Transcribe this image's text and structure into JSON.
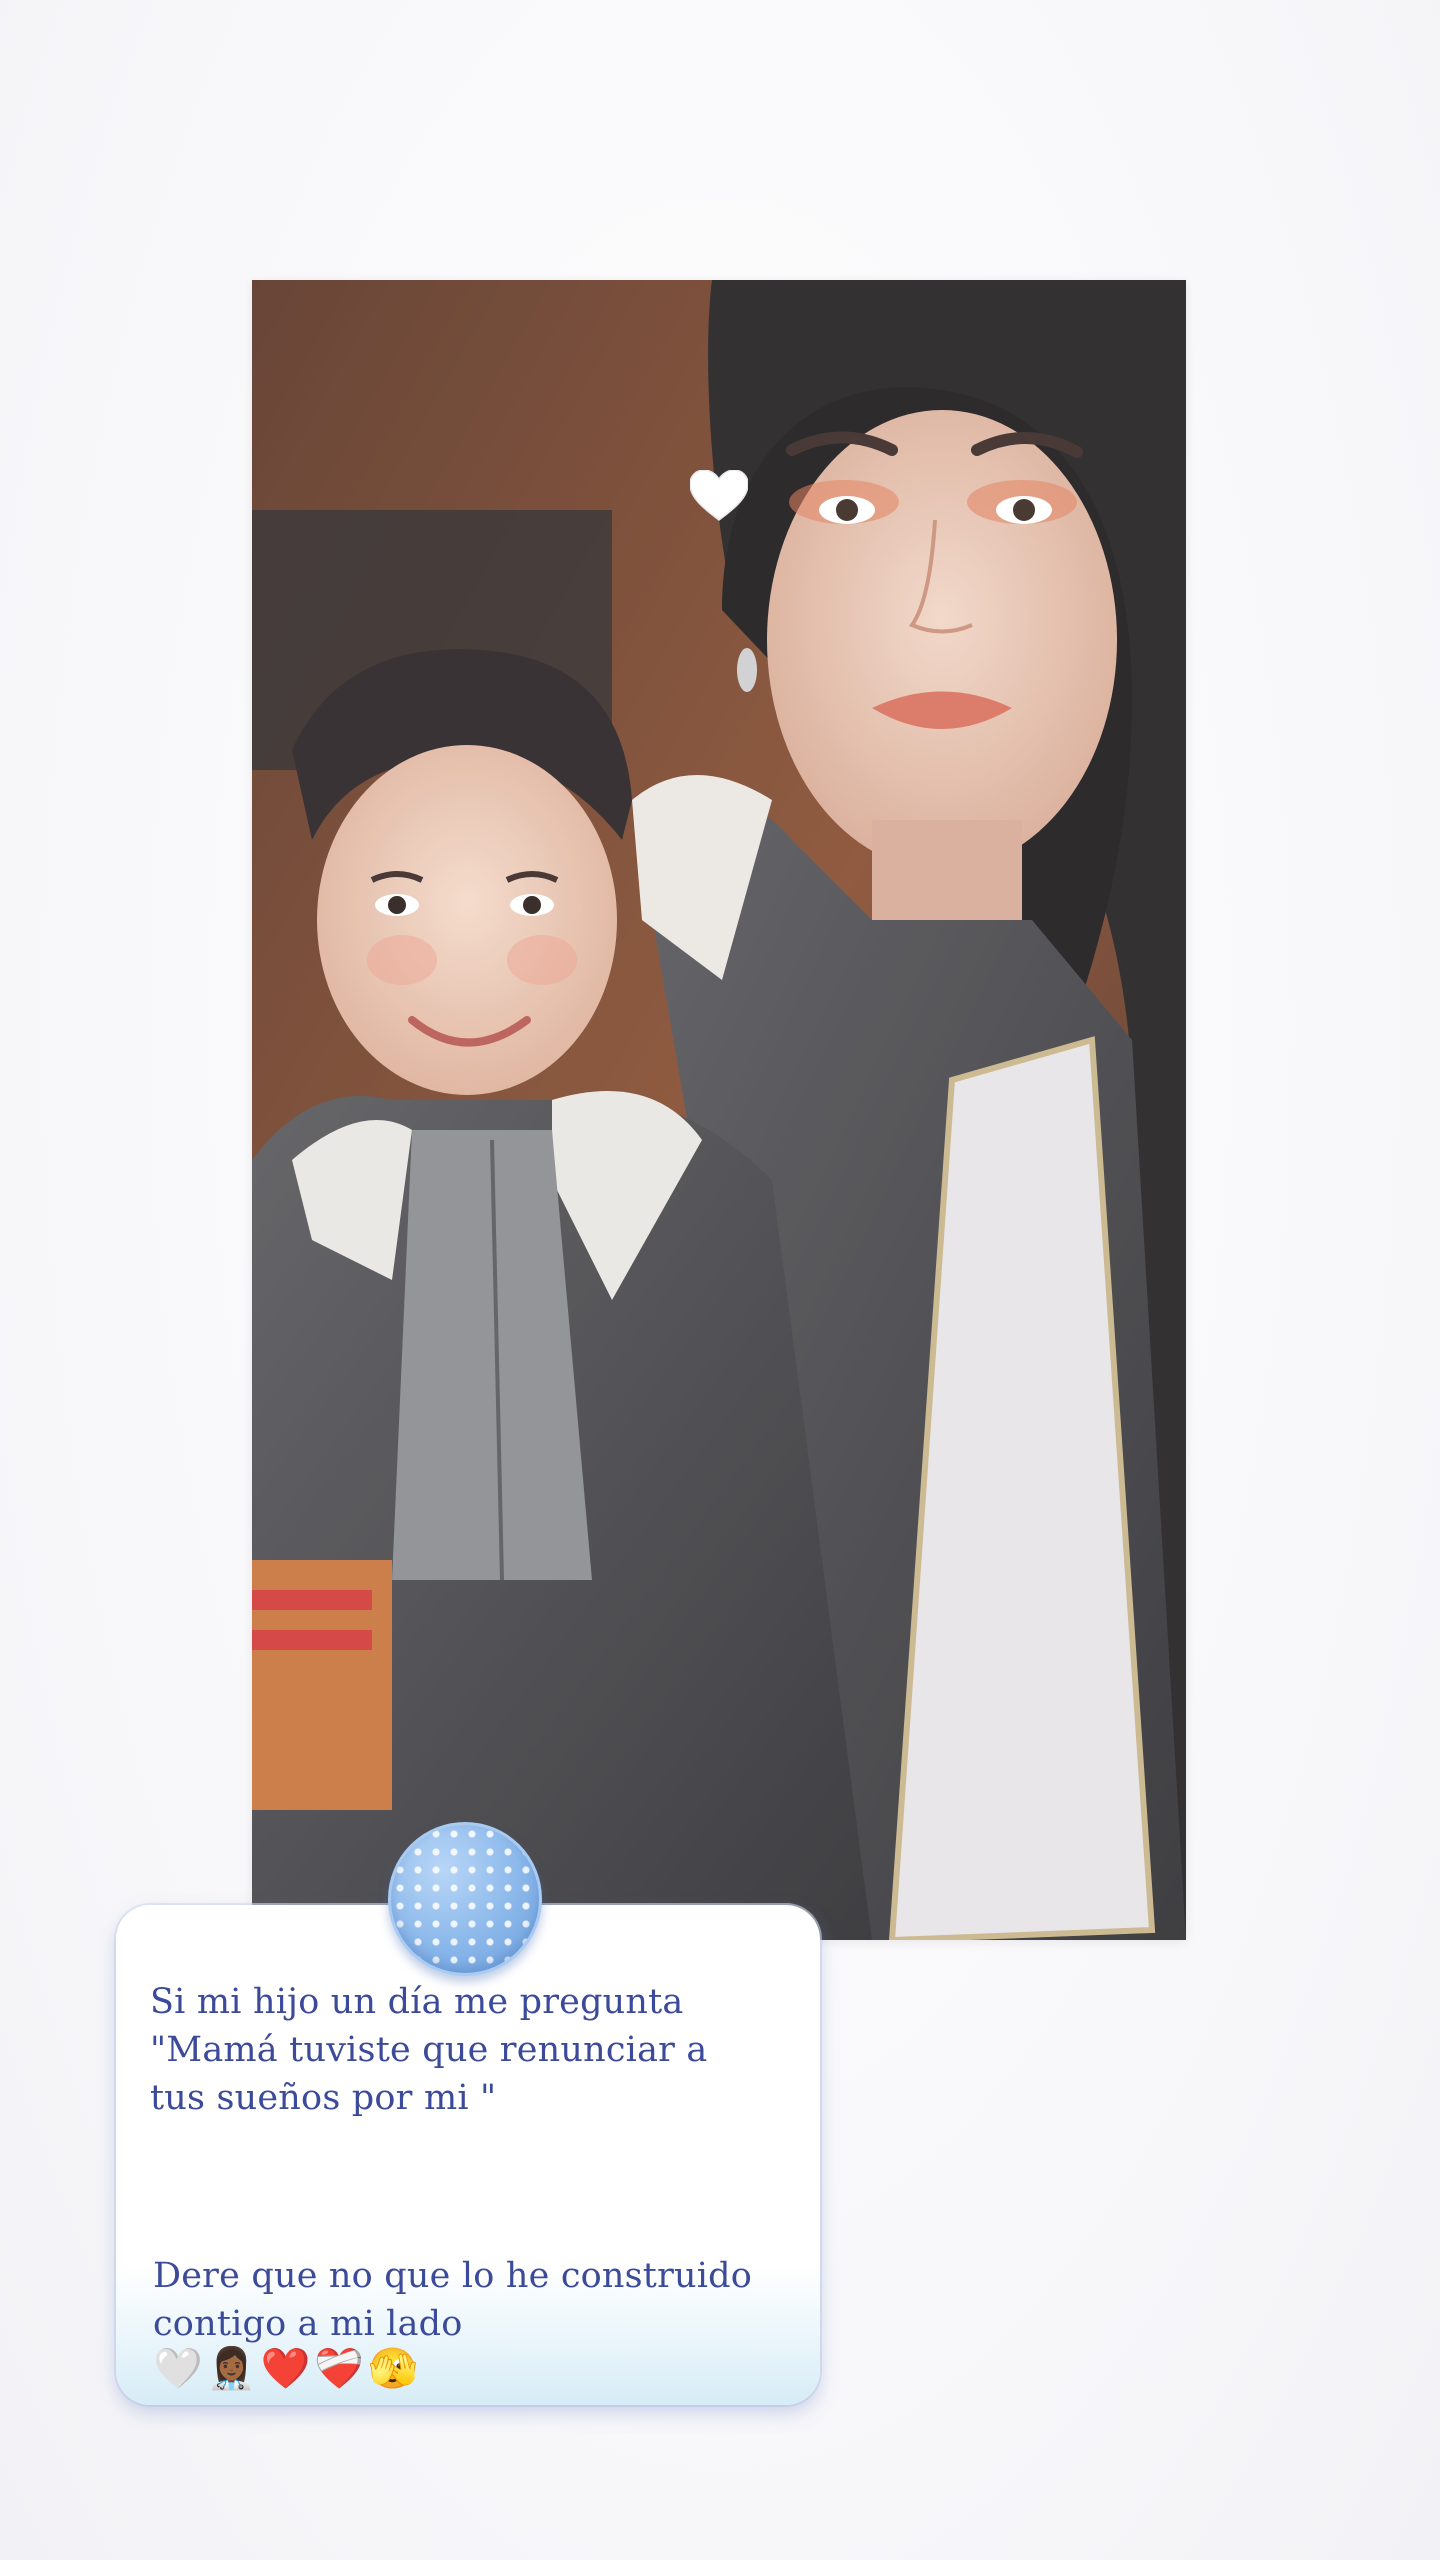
{
  "note": {
    "question": "Si mi hijo un día me pregunta\n\"Mamá tuviste que renunciar a\ntus sueños por mi  \"",
    "answer": "Dere que no que lo he construido\ncontigo a mi lado",
    "emojis": "🤍👩🏾‍⚕️❤️❤️‍🩹🫣"
  },
  "photo": {
    "subject": "selfie of a woman and a young boy wearing denim jackets with fleece collars"
  },
  "colors": {
    "note_text": "#3c4a9a",
    "pin": "#8ab7ea",
    "background": "#f7f7fa"
  },
  "icons": [
    "heart-icon",
    "pushpin-icon"
  ]
}
